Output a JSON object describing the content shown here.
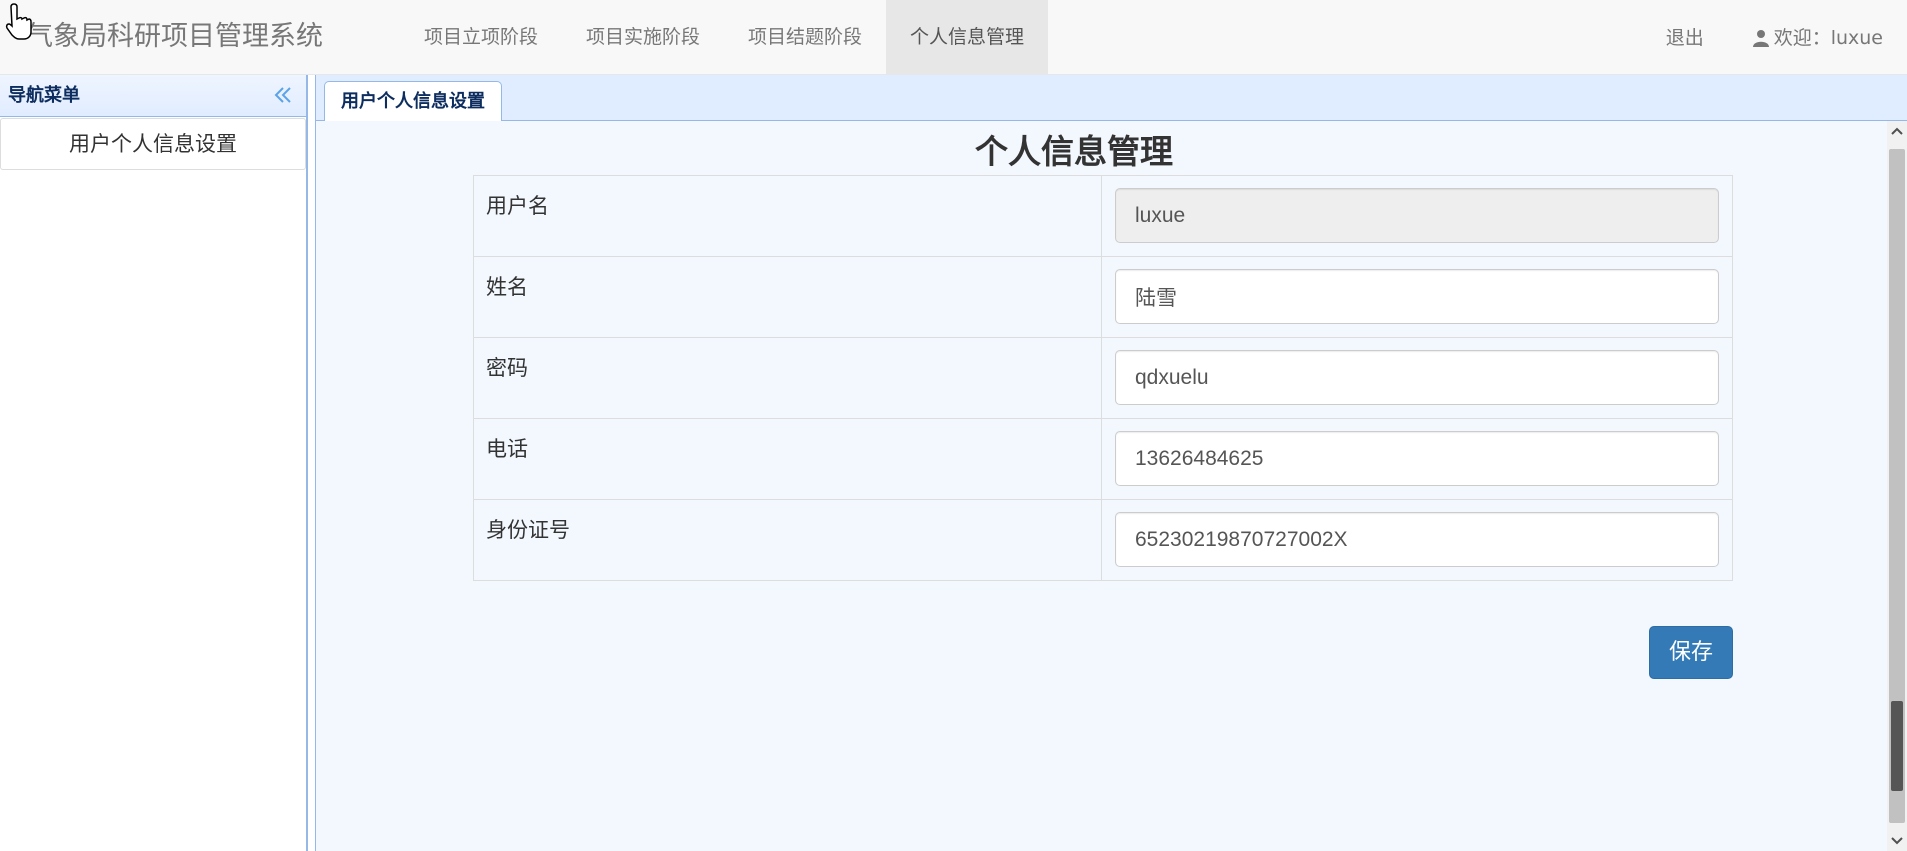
{
  "app": {
    "title": "气象局科研项目管理系统"
  },
  "navbar": {
    "items": [
      {
        "label": "项目立项阶段"
      },
      {
        "label": "项目实施阶段"
      },
      {
        "label": "项目结题阶段"
      },
      {
        "label": "个人信息管理"
      }
    ],
    "active_index": 3,
    "logout_label": "退出",
    "welcome_label": "欢迎：luxue",
    "user_icon": "user-icon"
  },
  "sidebar": {
    "title": "导航菜单",
    "collapse_icon": "double-chevron-left-icon",
    "items": [
      {
        "label": "用户个人信息设置"
      }
    ]
  },
  "tabs": [
    {
      "label": "用户个人信息设置"
    }
  ],
  "form": {
    "title": "个人信息管理",
    "rows": [
      {
        "label": "用户名",
        "value": "luxue",
        "readonly": true
      },
      {
        "label": "姓名",
        "value": "陆雪",
        "readonly": false
      },
      {
        "label": "密码",
        "value": "qdxuelu",
        "readonly": false
      },
      {
        "label": "电话",
        "value": "13626484625",
        "readonly": false
      },
      {
        "label": "身份证号",
        "value": "65230219870727002X",
        "readonly": false
      }
    ],
    "save_label": "保存"
  },
  "colors": {
    "primary_button": "#337ab7",
    "panel_border": "#95b8e7",
    "panel_header": "#e0ecff",
    "content_bg": "#f3f8fe",
    "sidebar_title": "#0e2d5f"
  }
}
